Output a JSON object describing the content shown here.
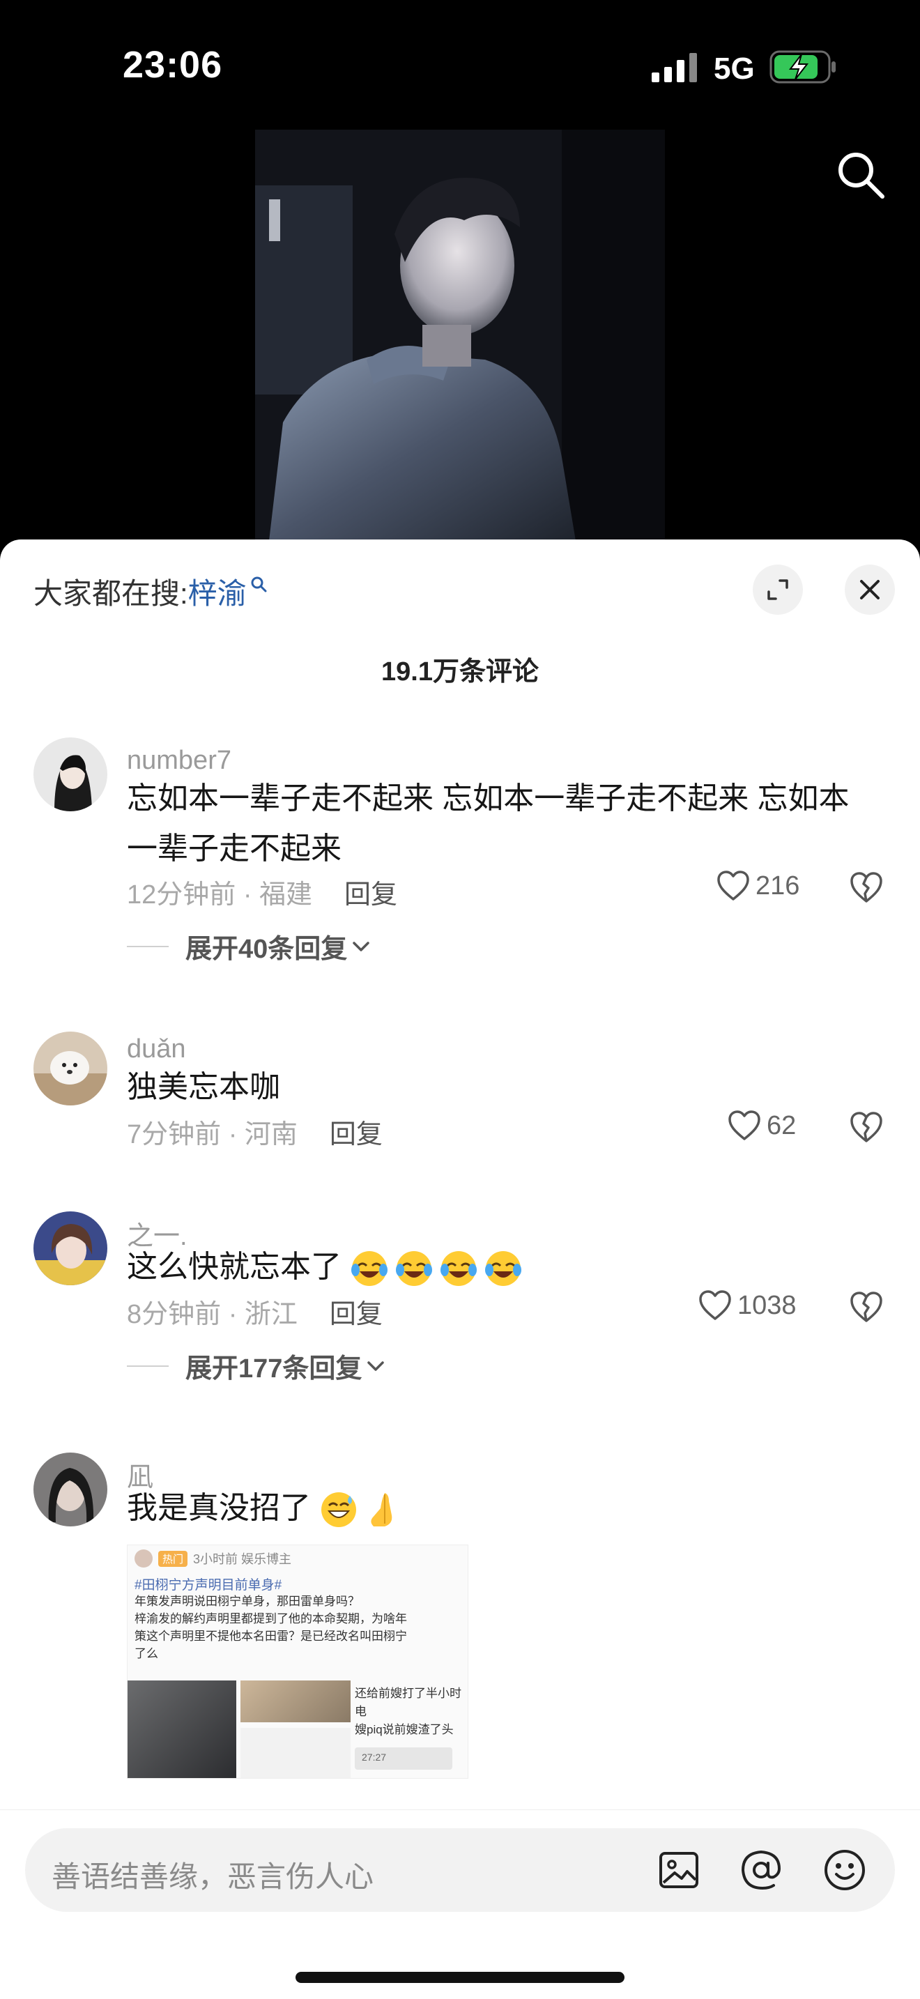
{
  "status": {
    "time": "23:06",
    "network": "5G"
  },
  "hot_search": {
    "prefix": "大家都在搜:",
    "keyword": "梓渝"
  },
  "comment_count": "19.1万条评论",
  "comments": [
    {
      "username": "number7",
      "text": "忘如本一辈子走不起来 忘如本一辈子走不起来 忘如本一辈子走不起来",
      "time_location": "12分钟前 · 福建",
      "reply_label": "回复",
      "likes": "216",
      "expand_replies": "展开40条回复"
    },
    {
      "username": "duǎn",
      "text": "独美忘本咖",
      "time_location": "7分钟前 · 河南",
      "reply_label": "回复",
      "likes": "62"
    },
    {
      "username": "之一.",
      "text": "这么快就忘本了",
      "time_location": "8分钟前 · 浙江",
      "reply_label": "回复",
      "likes": "1038",
      "expand_replies": "展开177条回复"
    },
    {
      "username": "凪",
      "text": "我是真没招了"
    }
  ],
  "image_text": {
    "tag": "热门",
    "header": "3小时前  娱乐博主",
    "title": "#田栩宁方声明目前单身#",
    "line1": "年策发声明说田栩宁单身，那田雷单身吗？",
    "line2": "梓渝发的解约声明里都提到了他的本命契期，为啥年",
    "line3": "策这个声明里不提他本名田雷？是已经改名叫田栩宁",
    "line4": "了么",
    "right1": "还给前嫂打了半小时电",
    "right2": "嫂piq说前嫂渣了头",
    "time_stamp": "27:27"
  },
  "input": {
    "placeholder": "善语结善缘，恶言伤人心"
  },
  "colors": {
    "link": "#2a5fa8",
    "sheet_bg": "#ffffff",
    "pill_bg": "#f2f2f2"
  }
}
